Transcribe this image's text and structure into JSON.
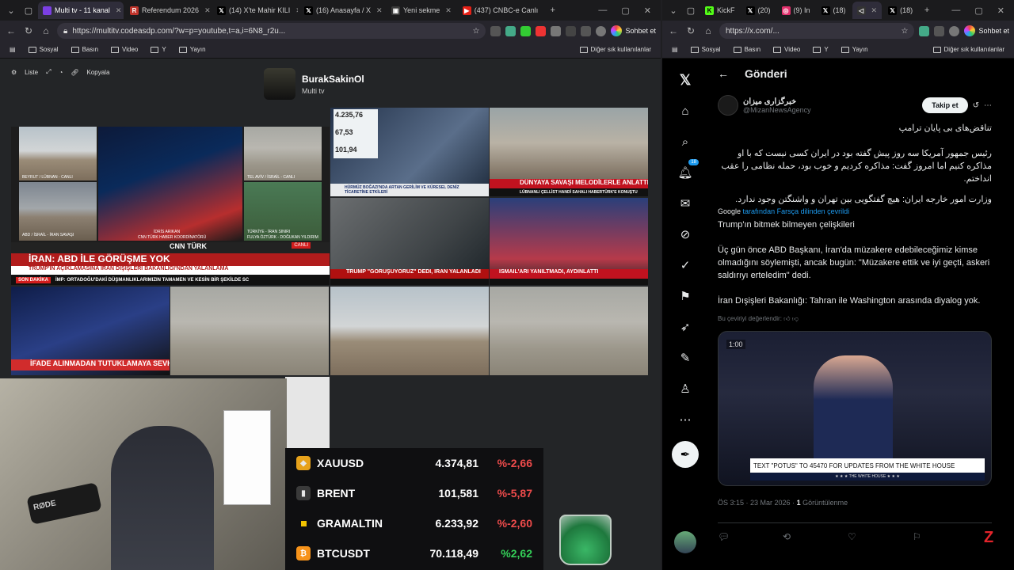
{
  "left": {
    "tabs": [
      {
        "label": "Multi tv - 11 kanal",
        "fav": "#7b3fe4",
        "active": true
      },
      {
        "label": "Referendum 2026",
        "fav": "#c0342b",
        "active": false
      },
      {
        "label": "(14) X'te Mahir KILI",
        "fav": "#000000",
        "active": false
      },
      {
        "label": "(16) Anasayfa / X",
        "fav": "#000000",
        "active": false
      },
      {
        "label": "Yeni sekme",
        "fav": "#3a3a3a",
        "active": false
      },
      {
        "label": "(437) CNBC-e Canlı",
        "fav": "#e62117",
        "active": false
      }
    ],
    "url": "https://multitv.codeasdp.com/?w=p=youtube,t=a,i=6N8_r2u...",
    "copilot": "Sohbet et",
    "bookmarks": [
      "Sosyal",
      "Basın",
      "Video",
      "Y",
      "Yayın"
    ],
    "bookmarks_more": "Diğer sık kullanılanlar",
    "toolbar": {
      "list": "Liste",
      "copy": "Kopyala"
    },
    "channel": {
      "name": "BurakSakinOl",
      "subtitle": "Multi tv"
    },
    "tiles": {
      "t1_labels": [
        "BEYRUT / LÜBNAN - CANLI",
        "TEL AVİV / İSRAİL - CANLI",
        "ABD / İSRAİL - İRAN SAVAŞI",
        "İDRİS ARIKAN",
        "CNN TÜRK HABER KOORDİNATÖRÜ",
        "TÜRKİYE - İRAN SINIRI",
        "FULYA ÖZTÜRK - DOĞUKAN YILDIRIM"
      ],
      "t1_logo": "CNN TÜRK",
      "t1_live": "CANLI",
      "t1_headline": "İRAN: ABD İLE GÖRÜŞME YOK",
      "t1_sub": "TRUMP'IN AÇIKLAMASINA İRAN DIŞİŞLERİ BAKANLIĞI'NDAN YALANLAMA",
      "t1_breaking": "SON DAKİKA",
      "t1_scroll": "İMP: ORTADOĞU'DAKİ DÜŞMANLIKLARIMIZIN TAMAMEN VE KESİN BİR ŞEKİLDE SC",
      "t2_prices": [
        "4.235,76",
        "67,53",
        "101,94"
      ],
      "t2_headline": "HÜRMÜZ BOĞAZI'NDA ARTAN GERİLİM VE KÜRESEL DENİZ TİCARETİNE ETKİLERİ",
      "t3_headline": "DÜNYAYA SAVAŞI MELODİLERLE ANLATTI",
      "t3_sub": "LÜBNANLI ÇELLİST HANDİ SAHALI HABERTÜRK'E KONUŞTU",
      "t4_headline": "TRUMP \"GÖRÜŞÜYORUZ\" DEDİ, İRAN YALANLADI",
      "t5_headline": "İSMAİL'ARI YANILTMADI, AYDINLATTI",
      "t6_headline": "İFADE ALINMADAN TUTUKLAMAYA SEVK"
    },
    "markets": [
      {
        "sym": "XAUUSD",
        "val": "4.374,81",
        "chg": "%-2,66",
        "dir": "neg",
        "icon": "gold-icon",
        "color": "#e7a21b"
      },
      {
        "sym": "BRENT",
        "val": "101,581",
        "chg": "%-5,87",
        "dir": "neg",
        "icon": "oil-barrel-icon",
        "color": "#3a3a3a"
      },
      {
        "sym": "GRAMALTIN",
        "val": "6.233,92",
        "chg": "%-2,60",
        "dir": "neg",
        "icon": "gold-bar-icon",
        "color": "#f2c200"
      },
      {
        "sym": "BTCUSDT",
        "val": "70.118,49",
        "chg": "%2,62",
        "dir": "pos",
        "icon": "bitcoin-icon",
        "color": "#f7931a"
      }
    ],
    "mic_brand": "RØDE"
  },
  "right": {
    "tabs": [
      {
        "label": "KickF",
        "fav": "#53fc18"
      },
      {
        "label": "(20)",
        "fav": "#000000"
      },
      {
        "label": "(9) In",
        "fav": "#e1306c"
      },
      {
        "label": "(18)",
        "fav": "#000000"
      },
      {
        "label": "",
        "fav": "#333333"
      },
      {
        "label": "(18)",
        "fav": "#000000"
      }
    ],
    "url": "https://x.com/...",
    "copilot": "Sohbet et",
    "bookmarks": [
      "Sosyal",
      "Basın",
      "Video",
      "Y",
      "Yayın"
    ],
    "bookmarks_more": "Diğer sık kullanılanlar",
    "notif_count": "18",
    "page_title": "Gönderi",
    "account_name": "خبرگزاری میزان",
    "handle": "@MizanNewsAgency",
    "follow": "Takip et",
    "fa_title": "تناقض‌های بی پایان ترامپ",
    "fa_body": "رئیس جمهور آمریکا سه روز پیش گفته بود در ایران کسی نیست که با او مذاکره کنیم اما امروز گفت: مذاکره کردیم و خوب بود، حمله نظامی را عقب انداختم.",
    "fa_body2": "وزارت امور خارجه ایران: هیچ گفتگویی بین تهران و واشنگتن وجود ندارد.",
    "google": "Google",
    "translated_note": "tarafından Farsça dilinden çevrildi",
    "tr_title": "Trump'ın bitmek bilmeyen çelişkileri",
    "tr_body": "Üç gün önce ABD Başkanı, İran'da müzakere edebileceğimiz kimse olmadığını söylemişti, ancak bugün: \"Müzakere ettik ve iyi geçti, askeri saldırıyı erteledim\" dedi.",
    "tr_body2": "İran Dışişleri Bakanlığı: Tahran ile Washington arasında diyalog yok.",
    "rate": "Bu çeviriyi değerlendir:",
    "video_time": "1:00",
    "video_caption": "TEXT \"POTUS\" TO 45470 FOR UPDATES FROM THE WHITE HOUSE",
    "video_caption2": "★ ★ ★ THE WHITE HOUSE ★ ★ ★",
    "timestamp": "ÖS 3:15 · 23 Mar 2026 · ",
    "views_count": "1",
    "views_label": " Görüntülenme"
  }
}
